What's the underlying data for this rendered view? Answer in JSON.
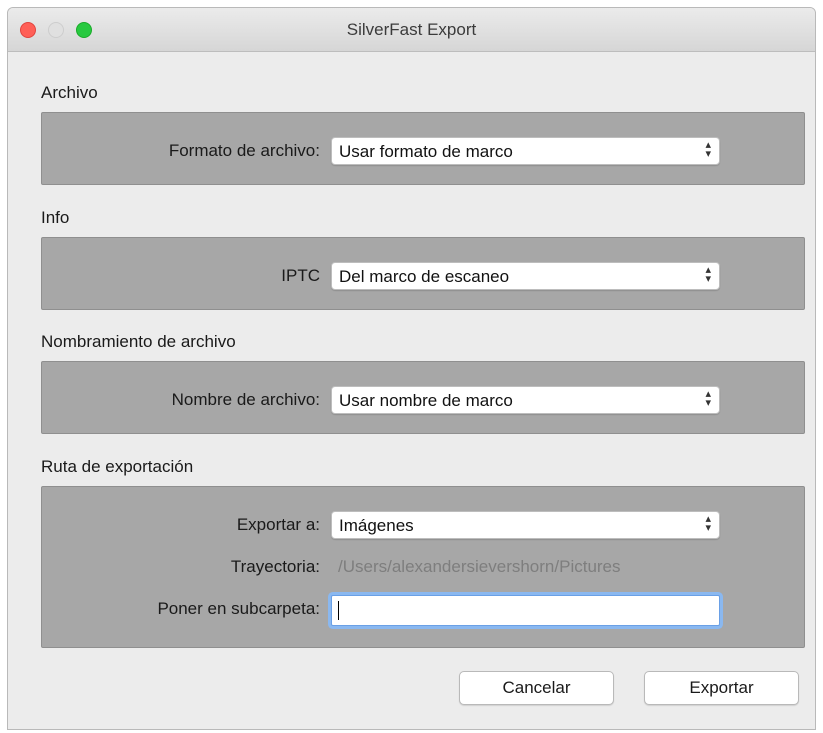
{
  "window": {
    "title": "SilverFast Export"
  },
  "sections": {
    "archivo": {
      "label": "Archivo",
      "format_label": "Formato de archivo:",
      "format_value": "Usar formato de marco"
    },
    "info": {
      "label": "Info",
      "iptc_label": "IPTC",
      "iptc_value": "Del marco de escaneo"
    },
    "naming": {
      "label": "Nombramiento de archivo",
      "name_label": "Nombre de archivo:",
      "name_value": "Usar nombre de marco"
    },
    "export_path": {
      "label": "Ruta de exportación",
      "export_to_label": "Exportar a:",
      "export_to_value": "Imágenes",
      "path_label": "Trayectoria:",
      "path_value": "/Users/alexandersievershorn/Pictures",
      "subfolder_label": "Poner en subcarpeta:",
      "subfolder_value": ""
    }
  },
  "buttons": {
    "cancel": "Cancelar",
    "export": "Exportar"
  },
  "icons": {
    "close": "close-traffic-light",
    "minimize": "minimize-traffic-light",
    "zoom": "zoom-traffic-light",
    "select_arrows": "up-down-chevrons-icon"
  },
  "colors": {
    "group_background": "#a7a7a7",
    "window_background": "#ececec",
    "focus_ring": "#8ab8f0",
    "close": "#ff5f57",
    "zoom": "#28c940"
  }
}
